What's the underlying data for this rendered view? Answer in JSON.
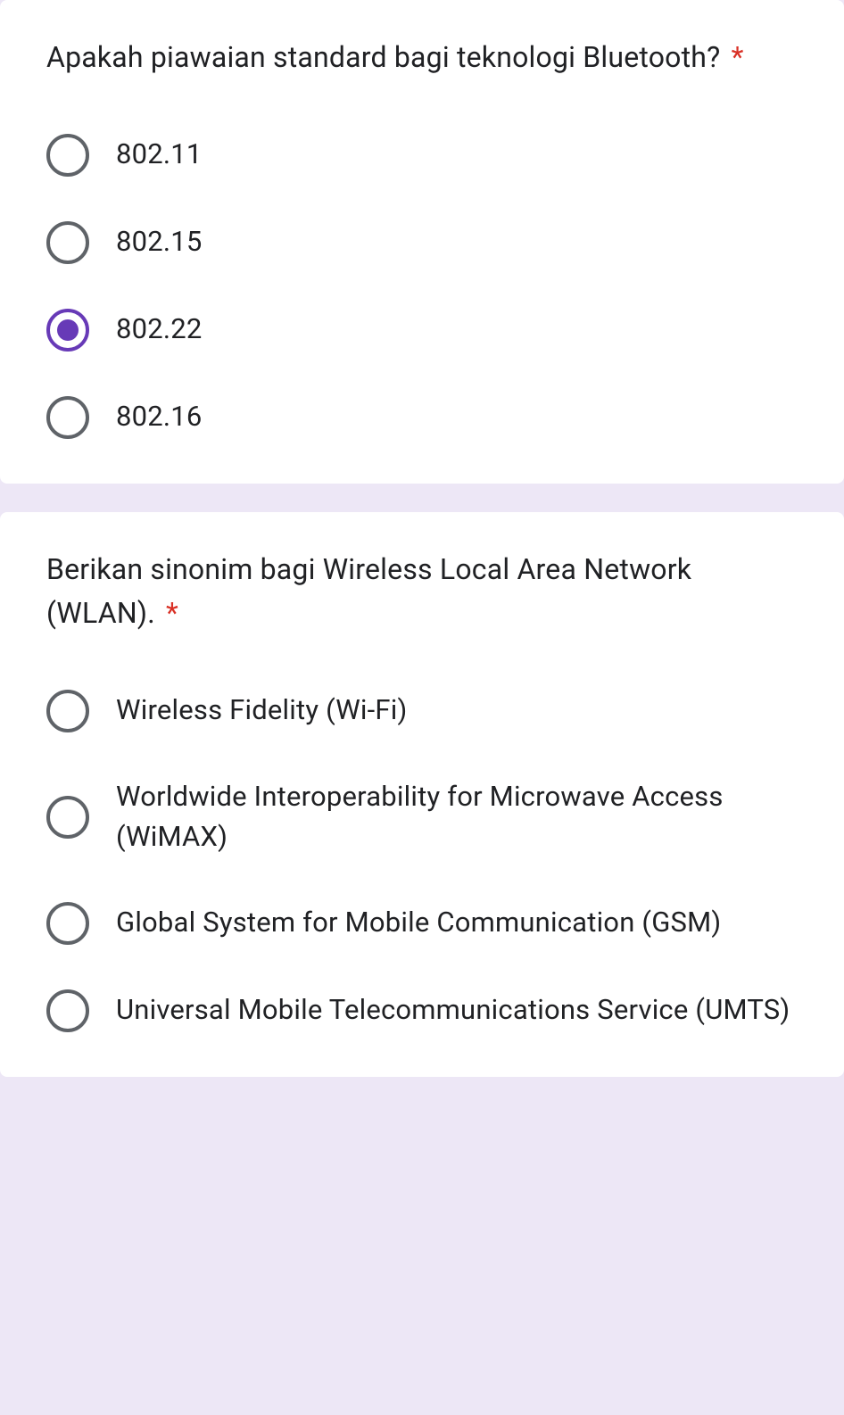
{
  "questions": [
    {
      "text": "Apakah piawaian standard bagi teknologi Bluetooth?",
      "required": true,
      "options": [
        {
          "label": "802.11",
          "selected": false
        },
        {
          "label": "802.15",
          "selected": false
        },
        {
          "label": "802.22",
          "selected": true
        },
        {
          "label": "802.16",
          "selected": false
        }
      ]
    },
    {
      "text": "Berikan sinonim bagi Wireless Local Area Network (WLAN).",
      "required": true,
      "options": [
        {
          "label": "Wireless Fidelity (Wi-Fi)",
          "selected": false
        },
        {
          "label": "Worldwide Interoperability for Microwave Access (WiMAX)",
          "selected": false
        },
        {
          "label": "Global System for Mobile Communication (GSM)",
          "selected": false
        },
        {
          "label": "Universal Mobile Telecommunications Service (UMTS)",
          "selected": false
        }
      ]
    }
  ],
  "requiredMarker": "*"
}
